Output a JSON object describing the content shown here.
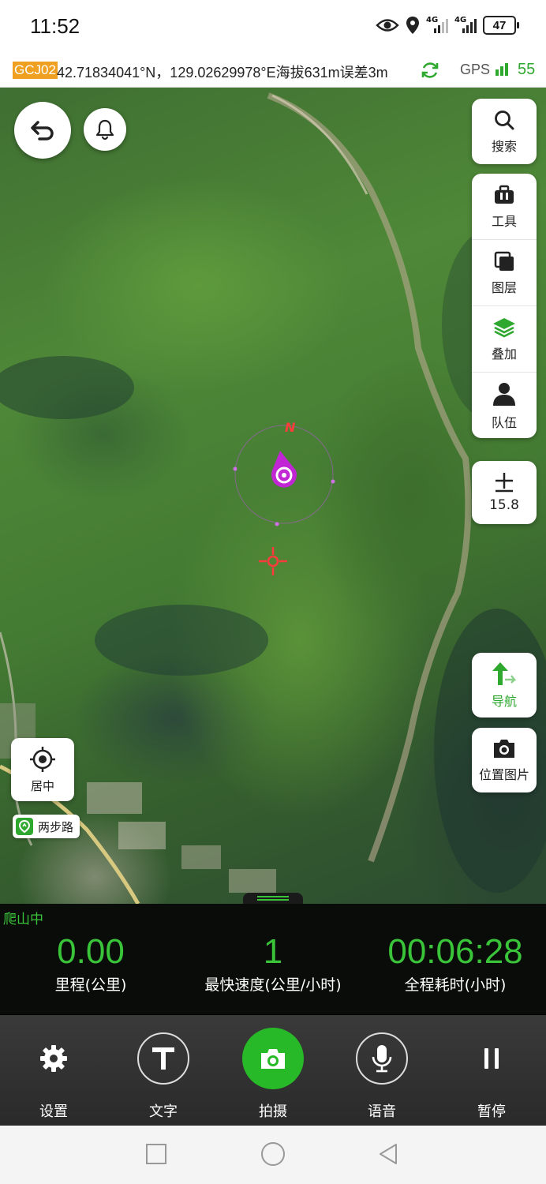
{
  "status_bar": {
    "time": "11:52",
    "net1": "4G",
    "net2": "4G",
    "battery": "47"
  },
  "gps_bar": {
    "crs": "GCJ02",
    "info": "42.71834041°N，129.02629978°E海拔631m误差3m",
    "gps_label": "GPS",
    "gps_value": "55"
  },
  "map": {
    "compass_label": "N",
    "right_tools": {
      "search": "搜索",
      "tool": "工具",
      "layers": "图层",
      "overlay": "叠加",
      "team": "队伍",
      "zoom_level": "15.8",
      "navigate": "导航",
      "photo_location": "位置图片"
    },
    "center_label": "居中",
    "brand_label": "两步路"
  },
  "stats": {
    "state": "爬山中",
    "distance_value": "0.00",
    "distance_label": "里程(公里)",
    "speed_value": "1",
    "speed_label": "最快速度(公里/小时)",
    "time_value": "00:06:28",
    "time_label": "全程耗时(小时)"
  },
  "toolbar": {
    "settings": "设置",
    "text": "文字",
    "shoot": "拍摄",
    "voice": "语音",
    "pause": "暂停"
  },
  "colors": {
    "accent_green": "#3ac43a",
    "crs_badge": "#f0a020",
    "marker_purple": "#c026d3"
  }
}
